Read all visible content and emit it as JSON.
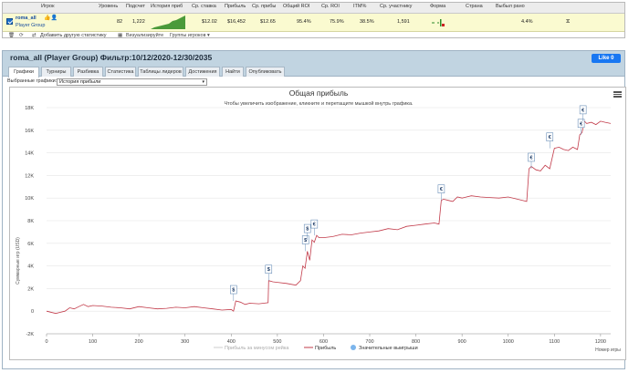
{
  "stats_table": {
    "headers": [
      "Игрок",
      "Уровень",
      "Подсчет",
      "История приб",
      "Ср. ставка",
      "Прибыль",
      "Ср. прибы",
      "Общий ROI",
      "Ср. ROI",
      "ITM%",
      "Ср. участнику",
      "Форма",
      "Страна",
      "Выбыл рано"
    ],
    "row": {
      "player": "roma_all",
      "group": "Player Group",
      "level": "82",
      "count": "1,222",
      "avg_stake": "$12.02",
      "profit": "$16,452",
      "avg_profit": "$12.65",
      "total_roi": "95.4%",
      "avg_roi": "75.9%",
      "itm": "38.5%",
      "avg_entrants": "1,591",
      "early_bust": "4.4%"
    },
    "tools": {
      "add_stat": "Добавить другую статистику",
      "visualize": "Визуализируйте",
      "groups": "Группы игроков"
    }
  },
  "panel": {
    "title": "roma_all (Player Group) Фильтр:10/12/2020-12/30/2035",
    "like_label": "Like 0",
    "tabs": [
      "Графики",
      "Турниры",
      "Разбивка",
      "Статистика",
      "Таблицы лидеров",
      "Достижения",
      "Найти",
      "Опубликовать"
    ],
    "selected_graph_label": "Выбранные графики:",
    "selected_graph_value": "История прибыли"
  },
  "chart_data": {
    "type": "line",
    "title": "Общая прибыль",
    "subtitle": "Чтобы увеличить изображение, кликните и перетащите мышкой внутрь графика.",
    "ylabel": "Суммарные игр (USD)",
    "xlabel": "Номер игры",
    "xlim": [
      0,
      1222
    ],
    "ylim": [
      -2000,
      18000
    ],
    "xticks": [
      0,
      100,
      200,
      300,
      400,
      500,
      600,
      700,
      800,
      900,
      1000,
      1100,
      1200
    ],
    "yticks": [
      -2000,
      0,
      2000,
      4000,
      6000,
      8000,
      10000,
      12000,
      14000,
      16000,
      18000
    ],
    "ytick_labels": [
      "-2K",
      "0",
      "2K",
      "4K",
      "6K",
      "8K",
      "10K",
      "12K",
      "14K",
      "16K",
      "18K"
    ],
    "legend": [
      "Прибыль за минусом рейка",
      "Прибыль",
      "Значительные выигрыши"
    ],
    "series": [
      {
        "name": "Прибыль",
        "color": "#c23b4a",
        "x": [
          0,
          20,
          30,
          40,
          50,
          60,
          70,
          80,
          90,
          100,
          120,
          140,
          160,
          180,
          200,
          220,
          240,
          260,
          280,
          300,
          320,
          340,
          360,
          380,
          400,
          405,
          410,
          420,
          430,
          440,
          460,
          470,
          480,
          481,
          490,
          500,
          520,
          540,
          550,
          555,
          560,
          565,
          570,
          575,
          580,
          585,
          590,
          600,
          620,
          640,
          660,
          680,
          700,
          720,
          740,
          760,
          780,
          800,
          820,
          840,
          850,
          855,
          860,
          870,
          880,
          890,
          900,
          920,
          940,
          960,
          980,
          1000,
          1020,
          1040,
          1045,
          1050,
          1060,
          1070,
          1080,
          1090,
          1100,
          1110,
          1120,
          1130,
          1140,
          1150,
          1155,
          1160,
          1165,
          1170,
          1180,
          1190,
          1200,
          1210,
          1222
        ],
        "y": [
          0,
          -200,
          -100,
          0,
          300,
          200,
          400,
          600,
          400,
          500,
          450,
          350,
          300,
          200,
          400,
          300,
          200,
          250,
          350,
          300,
          400,
          300,
          200,
          100,
          150,
          0,
          900,
          800,
          600,
          700,
          650,
          700,
          750,
          2700,
          2600,
          2550,
          2450,
          2300,
          2700,
          4000,
          3800,
          5300,
          4500,
          6300,
          6100,
          6700,
          6500,
          6500,
          6600,
          6800,
          6750,
          6900,
          7000,
          7100,
          7300,
          7200,
          7500,
          7600,
          7700,
          7800,
          7700,
          9800,
          9900,
          9800,
          9700,
          10100,
          10000,
          10200,
          10100,
          10050,
          10000,
          10100,
          9900,
          9700,
          12600,
          12800,
          12500,
          12400,
          12900,
          12600,
          14400,
          14500,
          14300,
          14200,
          14500,
          14300,
          15600,
          15800,
          16800,
          16600,
          16700,
          16500,
          16800,
          16700,
          16600
        ]
      }
    ],
    "big_wins": [
      {
        "x": 405,
        "y": 900,
        "label": "$"
      },
      {
        "x": 481,
        "y": 2700,
        "label": "$"
      },
      {
        "x": 561,
        "y": 5300,
        "label": "$"
      },
      {
        "x": 565,
        "y": 6300,
        "label": "$"
      },
      {
        "x": 580,
        "y": 6700,
        "label": "€"
      },
      {
        "x": 855,
        "y": 9800,
        "label": "€"
      },
      {
        "x": 1050,
        "y": 12600,
        "label": "€"
      },
      {
        "x": 1090,
        "y": 14400,
        "label": "€"
      },
      {
        "x": 1158,
        "y": 15600,
        "label": "€"
      },
      {
        "x": 1162,
        "y": 16800,
        "label": "€"
      }
    ]
  }
}
